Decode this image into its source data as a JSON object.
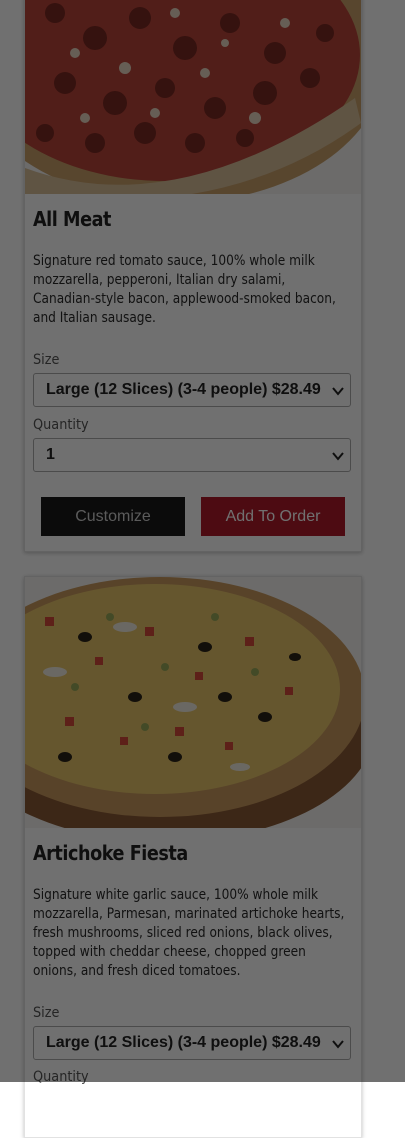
{
  "products": [
    {
      "name": "All Meat",
      "description": "Signature red tomato sauce, 100% whole milk mozzarella, pepperoni, Italian dry salami, Canadian-style bacon, applewood-smoked bacon, and Italian sausage.",
      "size_label": "Size",
      "size_value": "Large (12 Slices) (3-4 people) $28.49",
      "quantity_label": "Quantity",
      "quantity_value": "1",
      "customize_label": "Customize",
      "add_label": "Add To Order",
      "image_icon": "pizza-photo"
    },
    {
      "name": "Artichoke Fiesta",
      "description": "Signature white garlic sauce, 100% whole milk mozzarella, Parmesan, marinated artichoke hearts, fresh mushrooms, sliced red onions, black olives, topped with cheddar cheese, chopped green onions, and fresh diced tomatoes.",
      "size_label": "Size",
      "size_value": "Large (12 Slices) (3-4 people) $28.49",
      "quantity_label": "Quantity",
      "image_icon": "pizza-photo"
    }
  ],
  "colors": {
    "add_button": "#b01a2a",
    "customize_button": "#1b1b1b",
    "overlay": "rgba(0,0,0,0.56)"
  }
}
